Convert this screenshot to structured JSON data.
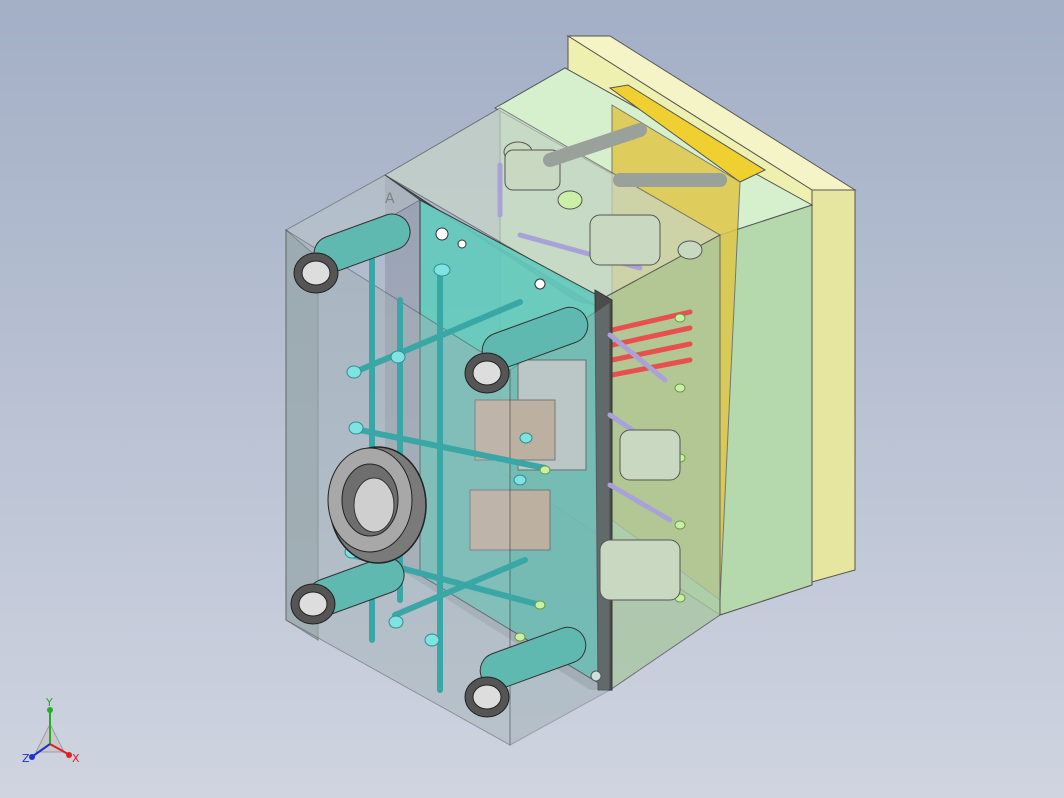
{
  "viewport": {
    "background_top": "#a3afc6",
    "background_bottom": "#cfd4e0"
  },
  "model": {
    "plate_marker": "A",
    "colors": {
      "top_clamp_plate": "#eef0b0",
      "green_plate": "#c6e6be",
      "cavity_plate": "#66cdbf",
      "transparent_block": "#9fb0b4",
      "yellow_insert": "#e0c84a",
      "cooling_line": "#7fe3e3",
      "ejector_pin": "#a9a2d8",
      "hot_runner": "#e85050",
      "guide_pillar": "#b8c4b8",
      "locating_ring": "#9a9a9a"
    }
  },
  "triad": {
    "x_label": "X",
    "y_label": "Y",
    "z_label": "Z",
    "x_color": "#e02020",
    "y_color": "#20b020",
    "z_color": "#2030d0"
  }
}
